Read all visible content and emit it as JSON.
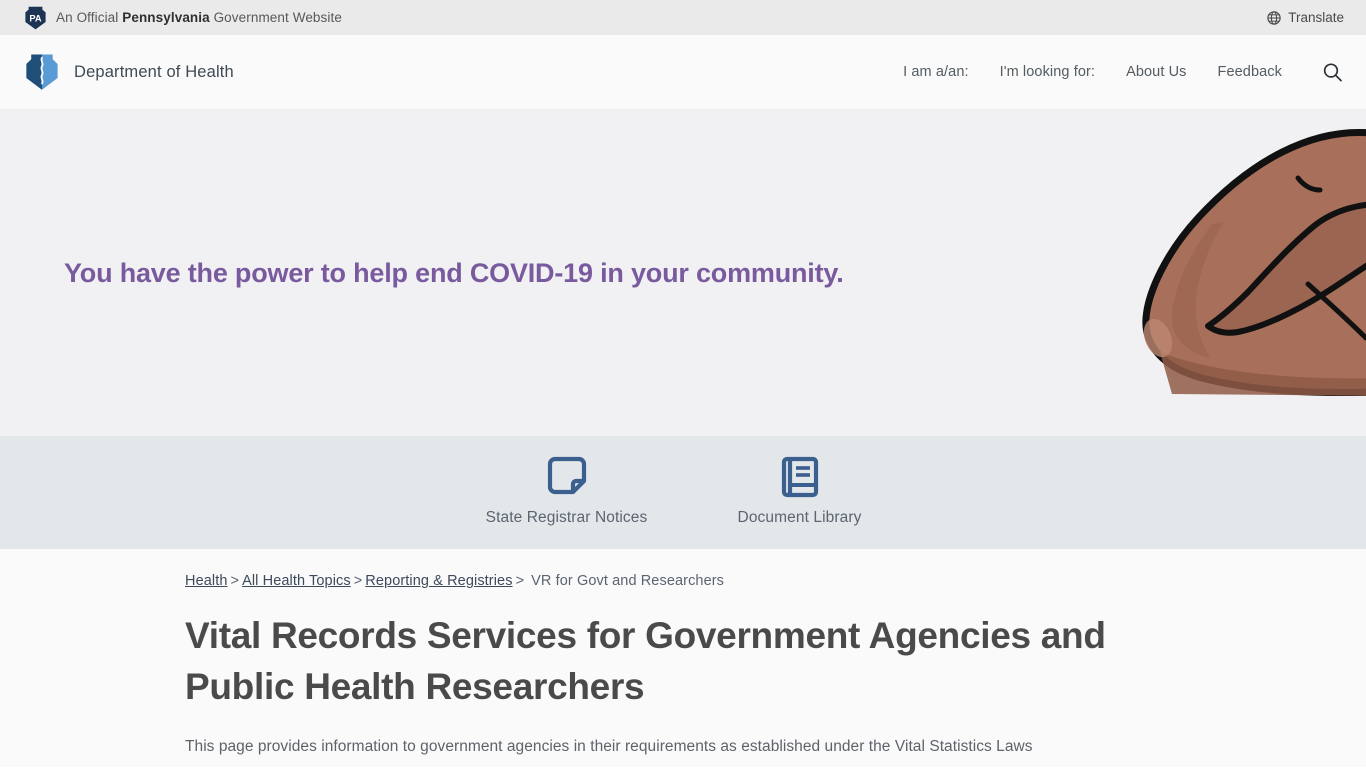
{
  "gov_banner": {
    "logo_icon": "pa-keystone-icon",
    "text_prefix": "An Official ",
    "text_bold": "Pennsylvania",
    "text_suffix": " Government Website",
    "translate_label": "Translate",
    "translate_icon": "globe-icon",
    "background": "#eaeaea"
  },
  "header": {
    "logo_icon": "doh-keystone-caduceus-icon",
    "brand_name": "Department of Health",
    "nav": [
      {
        "label": "I am a/an:"
      },
      {
        "label": "I'm looking for:"
      },
      {
        "label": "About Us"
      },
      {
        "label": "Feedback"
      }
    ],
    "search_icon": "search-icon",
    "background": "#fafafa"
  },
  "hero": {
    "headline": "You have the power to help end COVID-19 in your community.",
    "headline_color": "#7a5a9e",
    "background": "#f1f1f3",
    "illustration": "flexed-arm-illustration",
    "skin_color": "#a8705a",
    "skin_shadow": "#8f5b47"
  },
  "quicklinks": {
    "background": "#e3e7e9",
    "icon_color": "#3b5f8f",
    "items": [
      {
        "label": "State Registrar Notices",
        "icon": "note-page-icon"
      },
      {
        "label": "Document Library",
        "icon": "book-icon"
      }
    ]
  },
  "content": {
    "breadcrumb": {
      "links": [
        {
          "label": "Health"
        },
        {
          "label": "All Health Topics"
        },
        {
          "label": "Reporting & Registries"
        }
      ],
      "separator": ">",
      "current": "VR for Govt and Researchers"
    },
    "page_title": "Vital Records Services for Government Agencies and Public Health Researchers",
    "intro_text": "This page provides information to government agencies in their requirements as established under the Vital Statistics Laws"
  }
}
